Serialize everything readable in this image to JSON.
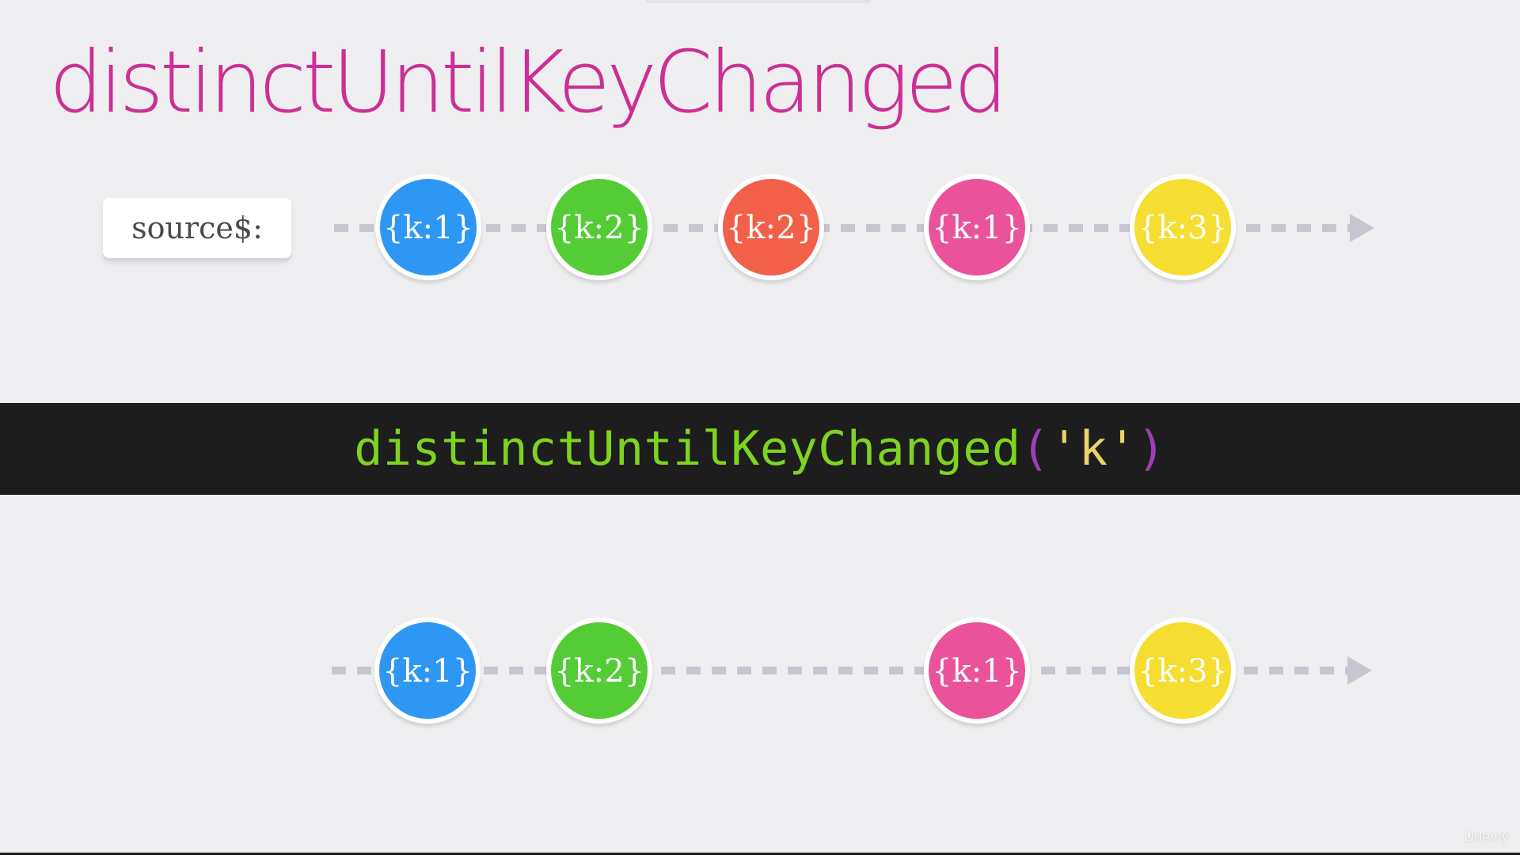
{
  "title": "distinctUntilKeyChanged",
  "source": {
    "label": "source$:",
    "marbles": [
      {
        "label": "{k:1}",
        "color": "#2f97f3"
      },
      {
        "label": "{k:2}",
        "color": "#53cc36"
      },
      {
        "label": "{k:2}",
        "color": "#f2604a"
      },
      {
        "label": "{k:1}",
        "color": "#ea539a"
      },
      {
        "label": "{k:3}",
        "color": "#f5dd30"
      }
    ]
  },
  "operator": {
    "name": "distinctUntilKeyChanged",
    "open_paren": "(",
    "argument": "'k'",
    "close_paren": ")"
  },
  "output": {
    "marbles": [
      {
        "label": "{k:1}",
        "color": "#2f97f3"
      },
      {
        "label": "{k:2}",
        "color": "#53cc36"
      },
      {
        "label": "{k:1}",
        "color": "#ea539a"
      },
      {
        "label": "{k:3}",
        "color": "#f5dd30"
      }
    ]
  },
  "colors": {
    "title": "#cc2f93",
    "timeline": "#c5c6cf",
    "operator_name": "#7ed321",
    "operator_paren": "#9c3fb8",
    "operator_argument": "#e8d46b"
  },
  "watermark": "Udemy"
}
